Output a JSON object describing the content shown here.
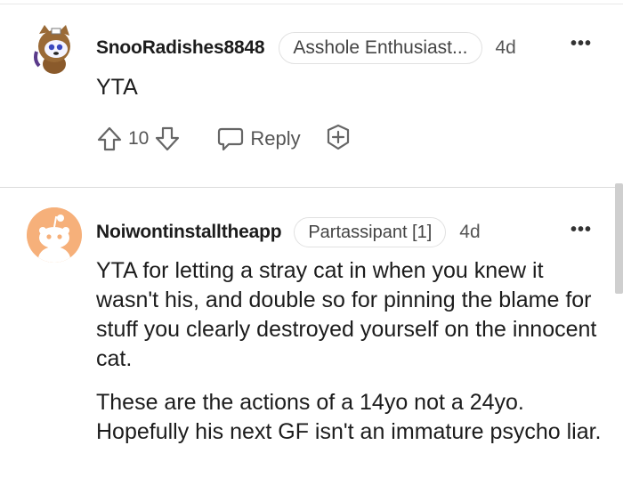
{
  "comments": [
    {
      "username": "SnooRadishes8848",
      "flair": "Asshole Enthusiast...",
      "age": "4d",
      "paragraphs": [
        "YTA"
      ],
      "score": "10",
      "reply_label": "Reply"
    },
    {
      "username": "Noiwontinstalltheapp",
      "flair": "Partassipant [1]",
      "age": "4d",
      "paragraphs": [
        "YTA for letting a stray cat in when you knew it wasn't his, and double so for pinning the blame for stuff you clearly destroyed yourself on the innocent cat.",
        "These are the actions of a 14yo not a 24yo. Hopefully his next GF isn't an immature psycho liar."
      ]
    }
  ],
  "more_glyph": "•••",
  "colors": {
    "avatar_orange": "#f6b07a",
    "text": "#1c1c1c",
    "muted": "#555555"
  },
  "icons": [
    "snoo-avatar-icon",
    "upvote-icon",
    "downvote-icon",
    "reply-icon",
    "award-icon",
    "more-options-icon"
  ]
}
